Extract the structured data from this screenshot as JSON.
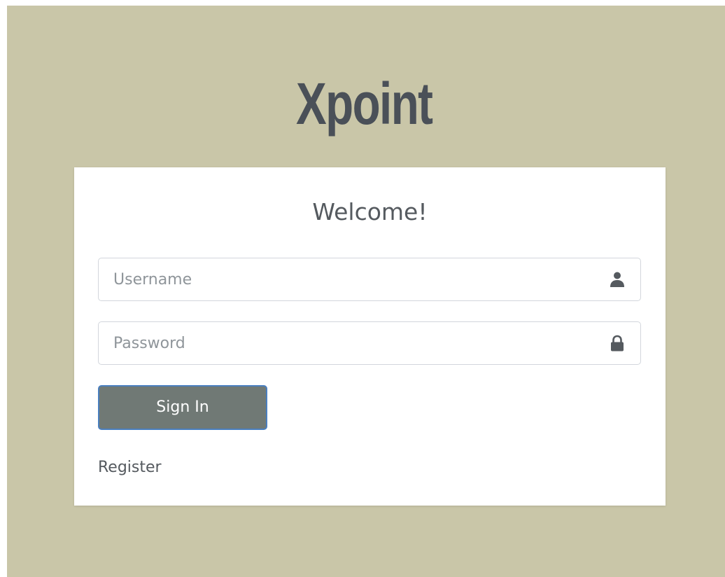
{
  "app": {
    "logo_text": "Xpoint"
  },
  "login_card": {
    "heading": "Welcome!",
    "username": {
      "placeholder": "Username",
      "value": "",
      "icon": "user-icon"
    },
    "password": {
      "placeholder": "Password",
      "value": "",
      "icon": "lock-icon"
    },
    "sign_in_label": "Sign In",
    "register_label": "Register"
  },
  "colors": {
    "background": "#c9c6a8",
    "logo": "#4a5058",
    "card": "#ffffff",
    "button": "#707975",
    "button_focus_border": "#4a7fbf",
    "text": "#555a5f"
  }
}
